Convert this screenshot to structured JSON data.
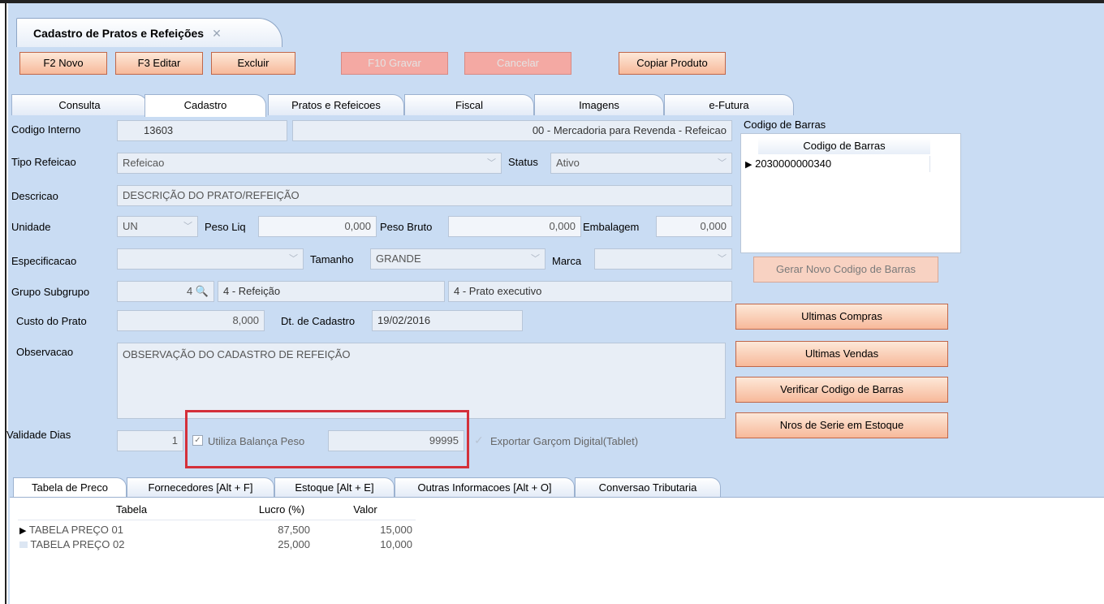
{
  "window": {
    "doc_tab_title": "Cadastro de Pratos e Refeições",
    "close_glyph": "✕"
  },
  "toolbar": {
    "new": "F2 Novo",
    "edit": "F3 Editar",
    "delete": "Excluir",
    "save": "F10 Gravar",
    "cancel": "Cancelar",
    "copy": "Copiar Produto"
  },
  "form_tabs": [
    "Consulta",
    "Cadastro",
    "Pratos e Refeicoes",
    "Fiscal",
    "Imagens",
    "e-Futura"
  ],
  "form": {
    "codigo_interno_label": "Codigo Interno",
    "codigo_interno": "13603",
    "categoria": "00 - Mercadoria para Revenda - Refeicao",
    "tipo_refeicao_label": "Tipo Refeicao",
    "tipo_refeicao": "Refeicao",
    "status_label": "Status",
    "status": "Ativo",
    "descricao_label": "Descricao",
    "descricao": "DESCRIÇÃO DO PRATO/REFEIÇÃO",
    "unidade_label": "Unidade",
    "unidade": "UN",
    "peso_liq_label": "Peso Liq",
    "peso_liq": "0,000",
    "peso_bruto_label": "Peso Bruto",
    "peso_bruto": "0,000",
    "embalagem_label": "Embalagem",
    "embalagem": "0,000",
    "especificacao_label": "Especificacao",
    "especificacao": "",
    "tamanho_label": "Tamanho",
    "tamanho": "GRANDE",
    "marca_label": "Marca",
    "marca": "",
    "grupo_label": "Grupo Subgrupo",
    "grupo_num": "4",
    "grupo": "4 - Refeição",
    "subgrupo": "4 - Prato executivo",
    "custo_label": "Custo do Prato",
    "custo": "8,000",
    "dt_cadastro_label": "Dt. de Cadastro",
    "dt_cadastro": "19/02/2016",
    "observacao_label": "Observacao",
    "observacao": "OBSERVAÇÃO DO CADASTRO DE REFEIÇÃO",
    "validade_label": "Validade Dias",
    "validade": "1",
    "balanca_label": "Utiliza Balança Peso",
    "balanca_code": "99995",
    "garcom_label": "Exportar Garçom Digital(Tablet)"
  },
  "barcode": {
    "section_label": "Codigo de Barras",
    "column": "Codigo de Barras",
    "rows": [
      "2030000000340"
    ],
    "generate_button": "Gerar Novo Codigo de Barras"
  },
  "side_buttons": {
    "ultimas_compras": "Ultimas Compras",
    "ultimas_vendas": "Ultimas Vendas",
    "verificar": "Verificar Codigo de Barras",
    "nros_serie": "Nros de Serie em Estoque"
  },
  "bottom_tabs": [
    "Tabela de Preco",
    "Fornecedores [Alt + F]",
    "Estoque [Alt + E]",
    "Outras Informacoes [Alt + O]",
    "Conversao Tributaria"
  ],
  "price_table": {
    "columns": [
      "Tabela",
      "Lucro (%)",
      "Valor"
    ],
    "rows": [
      {
        "tabela": "TABELA PREÇO 01",
        "lucro": "87,500",
        "valor": "15,000"
      },
      {
        "tabela": "TABELA PREÇO 02",
        "lucro": "25,000",
        "valor": "10,000"
      }
    ]
  },
  "colors": {
    "background": "#c9dcf3",
    "button": "#f7b99a",
    "highlight": "#d4303a"
  }
}
